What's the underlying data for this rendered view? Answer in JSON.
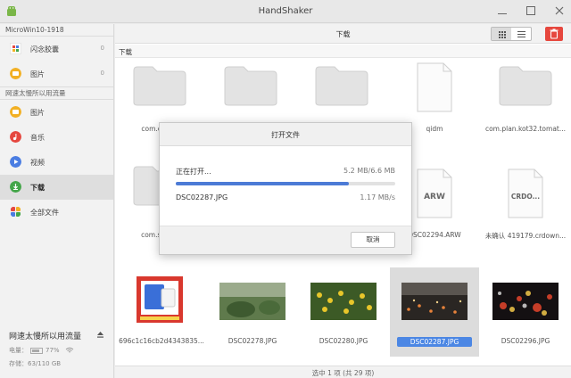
{
  "window": {
    "title": "HandShaker"
  },
  "sidebar": {
    "device_name": "MicroWin10-1918",
    "phone_items": [
      {
        "label": "闪念胶囊",
        "count": "0",
        "icon": "capsule-icon",
        "color": "#f7f7f7"
      },
      {
        "label": "图片",
        "count": "0",
        "icon": "picture-icon",
        "color": "#f2b024"
      }
    ],
    "section_label": "网速太慢所以用流量",
    "items": [
      {
        "label": "图片",
        "icon": "picture-icon",
        "color": "#f2b024"
      },
      {
        "label": "音乐",
        "icon": "music-icon",
        "color": "#e5473f"
      },
      {
        "label": "视频",
        "icon": "video-icon",
        "color": "#4a7de2"
      },
      {
        "label": "下载",
        "icon": "download-icon",
        "color": "#44a64a"
      },
      {
        "label": "全部文件",
        "icon": "all-files-icon",
        "color": "#ffffff"
      }
    ],
    "network_name": "网速太慢所以用流量",
    "battery_label": "电量：",
    "battery_percent": "77%",
    "battery_level": 0.77,
    "storage_label": "存储：",
    "storage_value": "63/110 GB"
  },
  "toolbar": {
    "title": "下载"
  },
  "breadcrumb": "下载",
  "files": [
    {
      "name": "com.caiyuni",
      "kind": "folder"
    },
    {
      "name": "",
      "kind": "folder"
    },
    {
      "name": "",
      "kind": "folder"
    },
    {
      "name": "qidm",
      "kind": "doc"
    },
    {
      "name": "com.plan.kot32.tomat...",
      "kind": "folder"
    },
    {
      "name": "com.ss.andr",
      "kind": "folder"
    },
    {
      "name": "",
      "kind": "hidden"
    },
    {
      "name": "",
      "kind": "hidden"
    },
    {
      "name": "DSC02294.ARW",
      "kind": "doc",
      "ext": "ARW"
    },
    {
      "name": "未确认 419179.crdown...",
      "kind": "doc",
      "ext": "CRDO..."
    },
    {
      "name": "696c1c16cb2d4343835...",
      "kind": "image"
    },
    {
      "name": "DSC02278.JPG",
      "kind": "image"
    },
    {
      "name": "DSC02280.JPG",
      "kind": "image"
    },
    {
      "name": "DSC02287.JPG",
      "kind": "image",
      "selected": true
    },
    {
      "name": "DSC02296.JPG",
      "kind": "image"
    }
  ],
  "status": "选中 1 项 (共 29 项)",
  "dialog": {
    "title": "打开文件",
    "label": "正在打开...",
    "size": "5.2 MB/6.6 MB",
    "progress": 0.79,
    "file_name": "DSC02287.JPG",
    "speed": "1.17 MB/s",
    "cancel_label": "取消"
  },
  "colors": {
    "accent": "#4c87e4",
    "delete": "#e6473e",
    "progress": "#4c7bd6"
  }
}
